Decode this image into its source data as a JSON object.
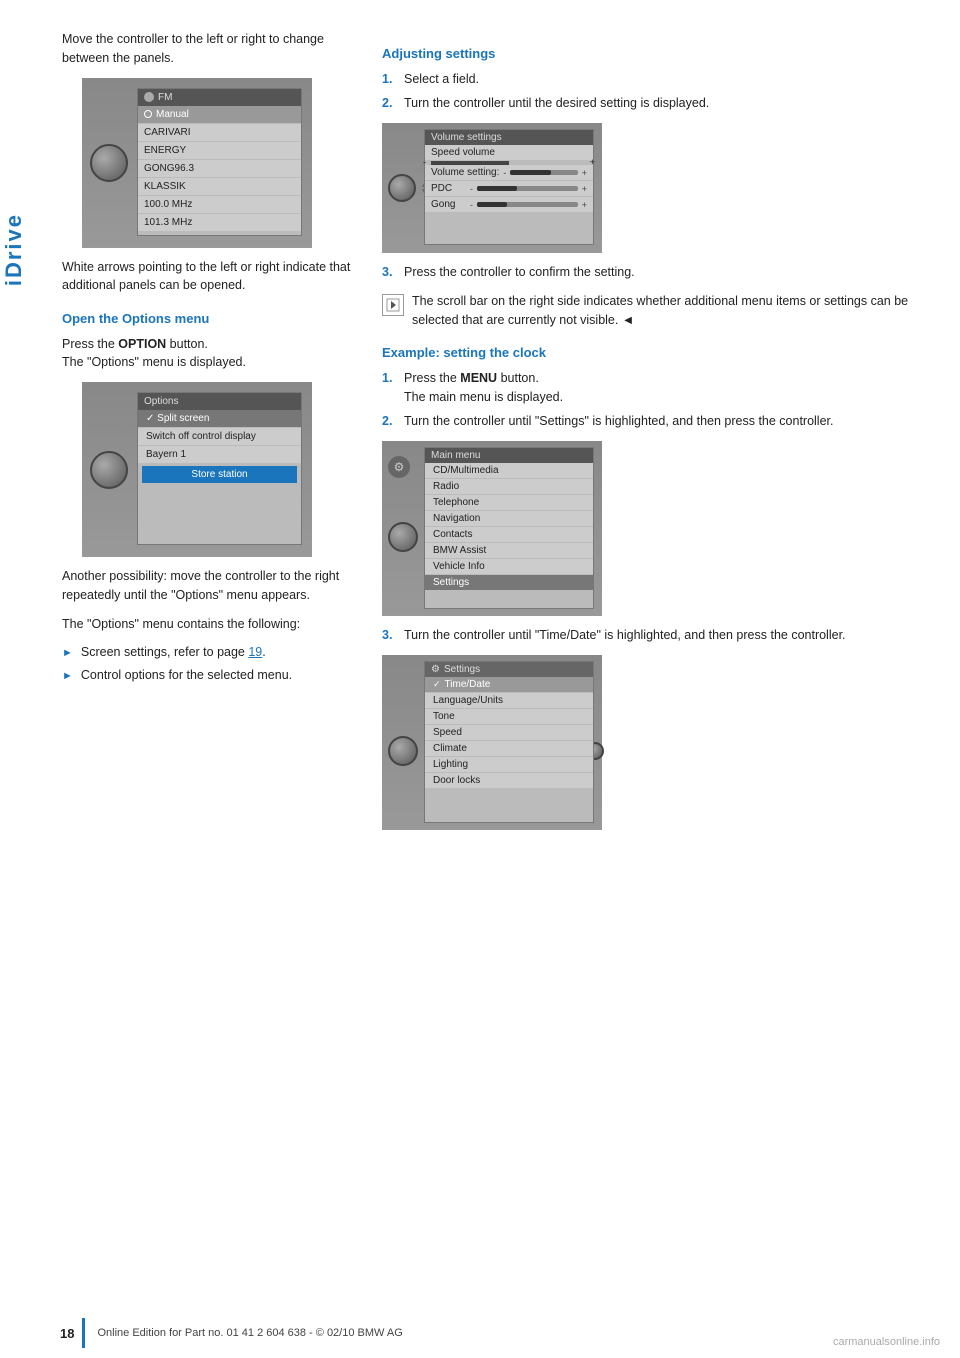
{
  "sidebar": {
    "label": "iDrive"
  },
  "left_col": {
    "intro_text": "Move the controller to the left or right to change between the panels.",
    "white_arrows_text": "White arrows pointing to the left or right indicate that additional panels can be opened.",
    "open_options_heading": "Open the Options menu",
    "open_options_p1": "Press the ",
    "open_options_option_bold": "OPTION",
    "open_options_p2": " button.",
    "open_options_p3": "The \"Options\" menu is displayed.",
    "another_possibility": "Another possibility: move the controller to the right repeatedly until the \"Options\" menu appears.",
    "options_contains": "The \"Options\" menu contains the following:",
    "bullet1": "Screen settings, refer to page ",
    "bullet1_link": "19",
    "bullet1_suffix": ".",
    "bullet2": "Control options for the selected menu."
  },
  "right_col": {
    "adjusting_heading": "Adjusting settings",
    "step1": "Select a field.",
    "step2": "Turn the controller until the desired setting is displayed.",
    "step3": "Press the controller to confirm the setting.",
    "scroll_note": "The scroll bar on the right side indicates whether additional menu items or settings can be selected that are currently not visible.",
    "end_marker": "◄",
    "example_heading": "Example: setting the clock",
    "ex_step1": "Press the ",
    "ex_step1_bold": "MENU",
    "ex_step1_suffix": " button.",
    "ex_step1_sub": "The main menu is displayed.",
    "ex_step2": "Turn the controller until \"Settings\" is highlighted, and then press the controller.",
    "ex_step3": "Turn the controller until \"Time/Date\" is highlighted, and then press the controller."
  },
  "fm_screen": {
    "header": "FM",
    "rows": [
      "Manual",
      "CARIVARI",
      "ENERGY",
      "GONG96.3",
      "KLASSIK",
      "100.0 MHz",
      "101.3 MHz"
    ]
  },
  "options_screen": {
    "header": "Options",
    "rows": [
      "Split screen",
      "Switch off control display",
      "Bayern 1",
      "Store station"
    ]
  },
  "vol_screen": {
    "header": "Volume settings",
    "top_label": "Speed volume",
    "rows": [
      {
        "label": "Volume setting:",
        "sublabel": "PDC",
        "fill": 60
      },
      {
        "label": "PDC",
        "fill": 40
      },
      {
        "label": "Gong",
        "fill": 30
      }
    ]
  },
  "main_menu_screen": {
    "header": "Main menu",
    "rows": [
      "CD/Multimedia",
      "Radio",
      "Telephone",
      "Navigation",
      "Contacts",
      "BMW Assist",
      "Vehicle Info",
      "Settings"
    ]
  },
  "settings_screen": {
    "header": "Settings",
    "rows": [
      "Time/Date",
      "Language/Units",
      "Tone",
      "Speed",
      "Climate",
      "Lighting",
      "Door locks"
    ]
  },
  "footer": {
    "page_number": "18",
    "footer_text": "Online Edition for Part no. 01 41 2 604 638 - © 02/10 BMW AG"
  }
}
